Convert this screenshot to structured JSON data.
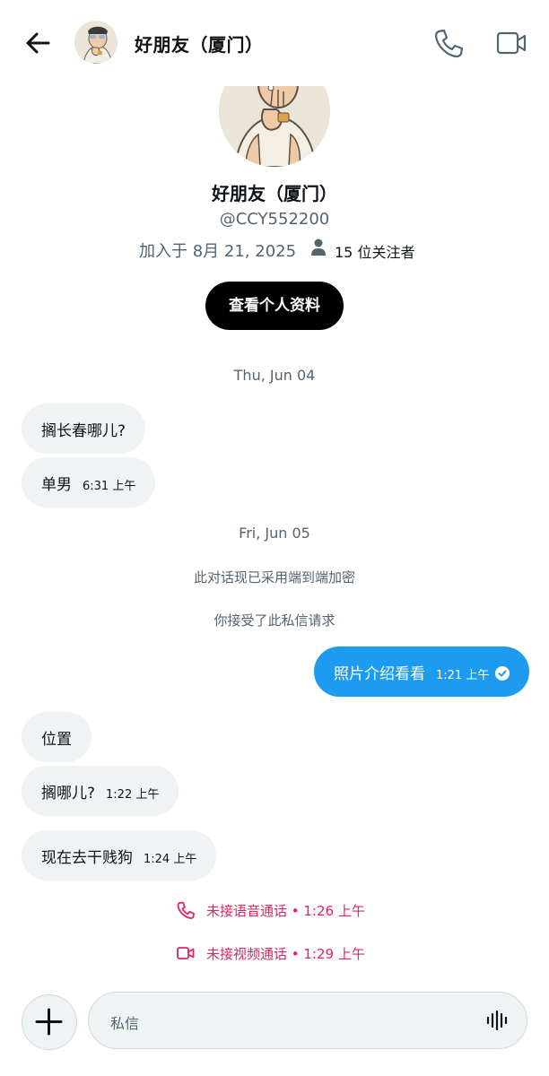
{
  "header": {
    "title": "好朋友（厦门）",
    "icons": [
      "back-arrow-icon",
      "phone-icon",
      "video-camera-icon"
    ]
  },
  "profile": {
    "name": "好朋友（厦门）",
    "handle": "@CCY552200",
    "joined": "加入于 8月 21, 2025",
    "followers": "15 位关注者",
    "view_profile_button": "查看个人资料"
  },
  "conversation": {
    "date_1": "Thu, Jun 04",
    "msg_1": {
      "text": "搁长春哪儿?"
    },
    "msg_2": {
      "text": "单男",
      "time": "6:31 上午"
    },
    "date_2": "Fri, Jun 05",
    "encryption_note": "此对话现已采用端到端加密",
    "accepted_note": "你接受了此私信请求",
    "msg_3": {
      "text": "照片介绍看看",
      "time": "1:21 上午"
    },
    "msg_4": {
      "text": "位置"
    },
    "msg_5": {
      "text": "搁哪儿?",
      "time": "1:22 上午"
    },
    "msg_6": {
      "text": "现在去干贱狗",
      "time": "1:24 上午"
    },
    "missed_voice": "未接语音通话 • 1:26 上午",
    "missed_video": "未接视频通话 • 1:29 上午"
  },
  "composer": {
    "placeholder": "私信",
    "icons": [
      "plus-icon",
      "voice-wave-icon"
    ]
  },
  "colors": {
    "accent_blue": "#1d9bf0",
    "missed_red": "#e0245e",
    "bubble_gray": "#eff3f4",
    "secondary_text": "#536471"
  }
}
